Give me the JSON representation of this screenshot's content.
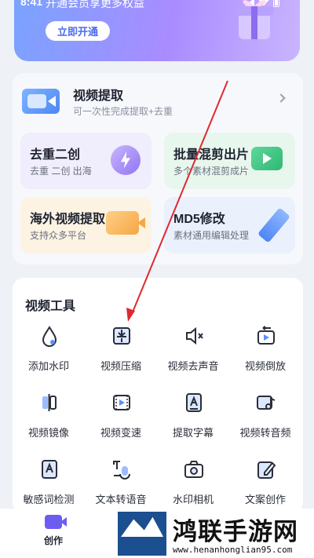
{
  "status": {
    "time": "8:41"
  },
  "vip": {
    "text": "开通会员享更多权益",
    "button": "立即开通"
  },
  "extract": {
    "title": "视频提取",
    "subtitle": "可一次性完成提取+去重"
  },
  "tiles": [
    {
      "title": "去重二创",
      "sub": "去重 二创 出海"
    },
    {
      "title": "批量混剪出片",
      "sub": "多个素材混剪成片"
    },
    {
      "title": "海外视频提取",
      "sub": "支持众多平台"
    },
    {
      "title": "MD5修改",
      "sub": "素材通用编辑处理"
    }
  ],
  "tools": {
    "title": "视频工具",
    "items": [
      {
        "label": "添加水印",
        "icon": "drop-icon"
      },
      {
        "label": "视频压缩",
        "icon": "compress-icon"
      },
      {
        "label": "视频去声音",
        "icon": "mute-icon"
      },
      {
        "label": "视频倒放",
        "icon": "reverse-icon"
      },
      {
        "label": "视频镜像",
        "icon": "mirror-icon"
      },
      {
        "label": "视频变速",
        "icon": "speed-icon"
      },
      {
        "label": "提取字幕",
        "icon": "subtitle-icon"
      },
      {
        "label": "视频转音频",
        "icon": "audio-icon"
      },
      {
        "label": "敏感词检测",
        "icon": "sensitive-icon"
      },
      {
        "label": "文本转语音",
        "icon": "tts-icon"
      },
      {
        "label": "水印相机",
        "icon": "camera-icon"
      },
      {
        "label": "文案创作",
        "icon": "write-icon"
      }
    ]
  },
  "nav": {
    "create": "创作"
  },
  "watermark": {
    "name": "鸿联手游网",
    "url": "www.henanhonglian95.com"
  },
  "colors": {
    "accent": "#4b6cf0",
    "arrow": "#e0282e"
  }
}
